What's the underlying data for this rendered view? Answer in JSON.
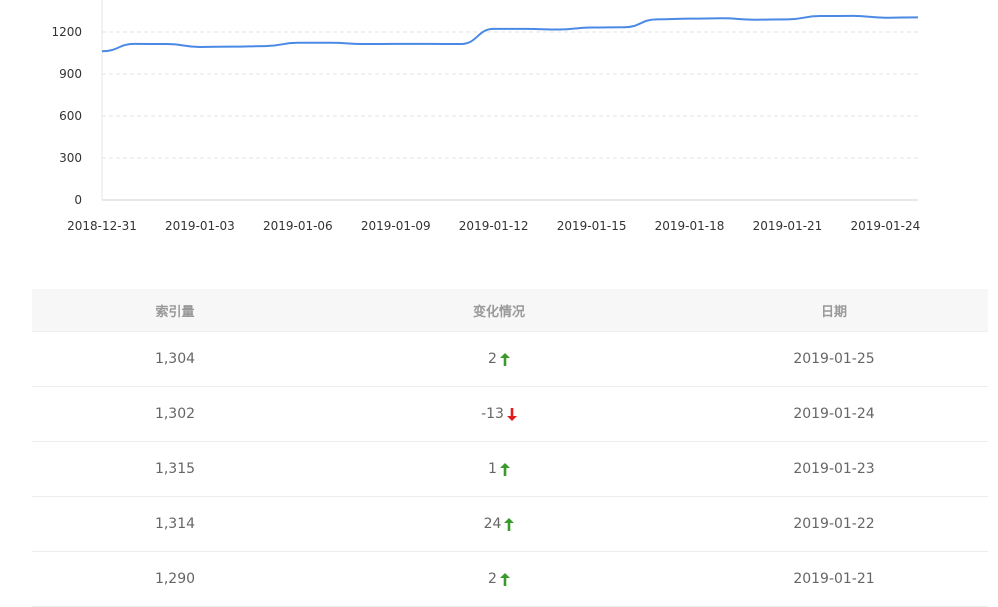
{
  "chart_data": {
    "type": "line",
    "title": "",
    "xlabel": "",
    "ylabel": "",
    "ylim": [
      0,
      1500
    ],
    "yticks": [
      0,
      300,
      600,
      900,
      1200
    ],
    "xtick_labels": [
      "2018-12-31",
      "2019-01-03",
      "2019-01-06",
      "2019-01-09",
      "2019-01-12",
      "2019-01-15",
      "2019-01-18",
      "2019-01-21",
      "2019-01-24"
    ],
    "grid": true,
    "line_color": "#4a8ae6",
    "series": [
      {
        "x": [
          "2018-12-31",
          "2019-01-01",
          "2019-01-02",
          "2019-01-03",
          "2019-01-04",
          "2019-01-05",
          "2019-01-06",
          "2019-01-07",
          "2019-01-08",
          "2019-01-09",
          "2019-01-10",
          "2019-01-11",
          "2019-01-12",
          "2019-01-13",
          "2019-01-14",
          "2019-01-15",
          "2019-01-16",
          "2019-01-17",
          "2019-01-18",
          "2019-01-19",
          "2019-01-20",
          "2019-01-21",
          "2019-01-22",
          "2019-01-23",
          "2019-01-24",
          "2019-01-25"
        ],
        "values": [
          1062,
          1115,
          1114,
          1093,
          1096,
          1099,
          1123,
          1123,
          1114,
          1115,
          1115,
          1114,
          1222,
          1222,
          1218,
          1232,
          1234,
          1290,
          1296,
          1298,
          1288,
          1290,
          1314,
          1315,
          1302,
          1304
        ]
      }
    ]
  },
  "table": {
    "headers": [
      "索引量",
      "变化情况",
      "日期"
    ],
    "rows": [
      {
        "count": "1,304",
        "change": "2",
        "direction": "up",
        "date": "2019-01-25"
      },
      {
        "count": "1,302",
        "change": "-13",
        "direction": "down",
        "date": "2019-01-24"
      },
      {
        "count": "1,315",
        "change": "1",
        "direction": "up",
        "date": "2019-01-23"
      },
      {
        "count": "1,314",
        "change": "24",
        "direction": "up",
        "date": "2019-01-22"
      },
      {
        "count": "1,290",
        "change": "2",
        "direction": "up",
        "date": "2019-01-21"
      }
    ],
    "up_color": "#3a9a2b",
    "down_color": "#e01e1e"
  }
}
